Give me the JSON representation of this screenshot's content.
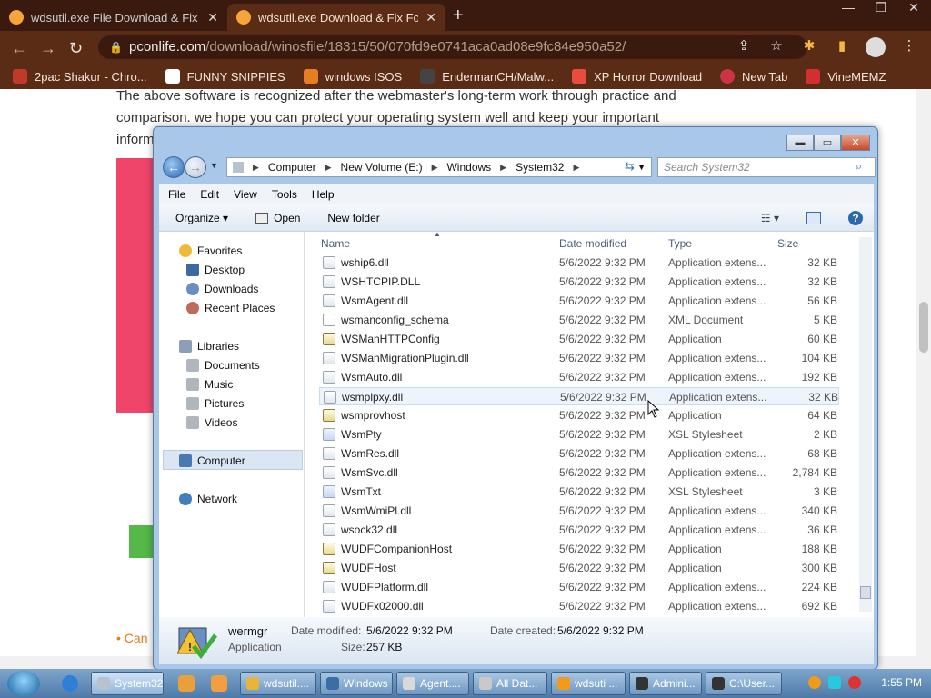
{
  "browser": {
    "tabs": [
      {
        "title": "wdsutil.exe File Download & Fix"
      },
      {
        "title": "wdsutil.exe Download & Fix For"
      }
    ],
    "url_host": "pconlife.com",
    "url_path": "/download/winosfile/18315/50/070fd9e0741aca0ad08e9fc84e950a52/",
    "bookmarks": [
      {
        "label": "2pac Shakur - Chro...",
        "color": "#c0392b"
      },
      {
        "label": "FUNNY SNIPPIES",
        "color": "#ffffff"
      },
      {
        "label": "windows ISOS",
        "color": "#e67e22"
      },
      {
        "label": "EndermanCH/Malw...",
        "color": "#444444"
      },
      {
        "label": "XP Horror Download",
        "color": "#e74c3c"
      },
      {
        "label": "New Tab",
        "color": "#cc3344"
      },
      {
        "label": "VineMEMZ",
        "color": "#d32f2f"
      }
    ]
  },
  "webpage": {
    "para1": "The above software is recognized after the webmaster's long-term work through practice and",
    "para2": "comparison. we hope you can protect your operating system well and keep your important",
    "para3": "inform",
    "link_partial": "• Can"
  },
  "explorer": {
    "breadcrumb": [
      "Computer",
      "New Volume (E:)",
      "Windows",
      "System32"
    ],
    "search_placeholder": "Search System32",
    "menu": [
      "File",
      "Edit",
      "View",
      "Tools",
      "Help"
    ],
    "commands": {
      "organize": "Organize ▾",
      "open": "Open",
      "new_folder": "New folder"
    },
    "nav": {
      "favorites": "Favorites",
      "desktop": "Desktop",
      "downloads": "Downloads",
      "recent": "Recent Places",
      "libraries": "Libraries",
      "documents": "Documents",
      "music": "Music",
      "pictures": "Pictures",
      "videos": "Videos",
      "computer": "Computer",
      "network": "Network"
    },
    "columns": {
      "name": "Name",
      "date": "Date modified",
      "type": "Type",
      "size": "Size"
    },
    "files": [
      {
        "name": "wship6.dll",
        "date": "5/6/2022 9:32 PM",
        "type": "Application extens...",
        "size": "32 KB",
        "kind": "dll"
      },
      {
        "name": "WSHTCPIP.DLL",
        "date": "5/6/2022 9:32 PM",
        "type": "Application extens...",
        "size": "32 KB",
        "kind": "dll"
      },
      {
        "name": "WsmAgent.dll",
        "date": "5/6/2022 9:32 PM",
        "type": "Application extens...",
        "size": "56 KB",
        "kind": "dll"
      },
      {
        "name": "wsmanconfig_schema",
        "date": "5/6/2022 9:32 PM",
        "type": "XML Document",
        "size": "5 KB",
        "kind": "xml"
      },
      {
        "name": "WSManHTTPConfig",
        "date": "5/6/2022 9:32 PM",
        "type": "Application",
        "size": "60 KB",
        "kind": "app"
      },
      {
        "name": "WSManMigrationPlugin.dll",
        "date": "5/6/2022 9:32 PM",
        "type": "Application extens...",
        "size": "104 KB",
        "kind": "dll"
      },
      {
        "name": "WsmAuto.dll",
        "date": "5/6/2022 9:32 PM",
        "type": "Application extens...",
        "size": "192 KB",
        "kind": "dll"
      },
      {
        "name": "wsmplpxy.dll",
        "date": "5/6/2022 9:32 PM",
        "type": "Application extens...",
        "size": "32 KB",
        "kind": "dll"
      },
      {
        "name": "wsmprovhost",
        "date": "5/6/2022 9:32 PM",
        "type": "Application",
        "size": "64 KB",
        "kind": "app"
      },
      {
        "name": "WsmPty",
        "date": "5/6/2022 9:32 PM",
        "type": "XSL Stylesheet",
        "size": "2 KB",
        "kind": "xsl"
      },
      {
        "name": "WsmRes.dll",
        "date": "5/6/2022 9:32 PM",
        "type": "Application extens...",
        "size": "68 KB",
        "kind": "dll"
      },
      {
        "name": "WsmSvc.dll",
        "date": "5/6/2022 9:32 PM",
        "type": "Application extens...",
        "size": "2,784 KB",
        "kind": "dll"
      },
      {
        "name": "WsmTxt",
        "date": "5/6/2022 9:32 PM",
        "type": "XSL Stylesheet",
        "size": "3 KB",
        "kind": "xsl"
      },
      {
        "name": "WsmWmiPl.dll",
        "date": "5/6/2022 9:32 PM",
        "type": "Application extens...",
        "size": "340 KB",
        "kind": "dll"
      },
      {
        "name": "wsock32.dll",
        "date": "5/6/2022 9:32 PM",
        "type": "Application extens...",
        "size": "36 KB",
        "kind": "dll"
      },
      {
        "name": "WUDFCompanionHost",
        "date": "5/6/2022 9:32 PM",
        "type": "Application",
        "size": "188 KB",
        "kind": "app"
      },
      {
        "name": "WUDFHost",
        "date": "5/6/2022 9:32 PM",
        "type": "Application",
        "size": "300 KB",
        "kind": "app"
      },
      {
        "name": "WUDFPlatform.dll",
        "date": "5/6/2022 9:32 PM",
        "type": "Application extens...",
        "size": "224 KB",
        "kind": "dll"
      },
      {
        "name": "WUDFx02000.dll",
        "date": "5/6/2022 9:32 PM",
        "type": "Application extens...",
        "size": "692 KB",
        "kind": "dll"
      }
    ],
    "details": {
      "name": "wermgr",
      "type": "Application",
      "modified_label": "Date modified:",
      "modified": "5/6/2022 9:32 PM",
      "created_label": "Date created:",
      "created": "5/6/2022 9:32 PM",
      "size_label": "Size:",
      "size": "257 KB"
    }
  },
  "taskbar": {
    "buttons": [
      "System32",
      "wdsutil....",
      "Windows",
      "Agent....",
      "All Dat...",
      "wdsuti ...",
      "Admini...",
      "C:\\User..."
    ],
    "clock": "1:55 PM"
  }
}
